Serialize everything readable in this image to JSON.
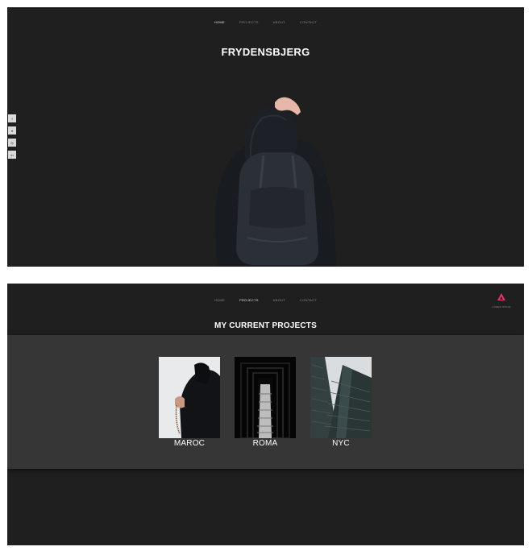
{
  "home": {
    "nav": [
      "HOME",
      "PROJECTS",
      "ABOUT",
      "CONTACT"
    ],
    "active_nav": "HOME",
    "title": "FRYDENSBJERG",
    "social": [
      "f",
      "t",
      "ig",
      "in"
    ]
  },
  "projects": {
    "nav": [
      "HOME",
      "PROJECTS",
      "ABOUT",
      "CONTACT"
    ],
    "active_nav": "PROJECTS",
    "logo_caption": "LOREM IPSUM",
    "logo_color": "#e8336c",
    "title": "MY CURRENT PROJECTS",
    "social": [
      "f",
      "t",
      "ig",
      "in"
    ],
    "cards": [
      {
        "label": "MAROC",
        "image": "woman-holding-prayer-beads"
      },
      {
        "label": "ROMA",
        "image": "symmetric-corridor"
      },
      {
        "label": "NYC",
        "image": "glass-skyscraper"
      }
    ]
  },
  "colors": {
    "page_bg": "#1f1f1f",
    "band_bg": "#363636",
    "text": "#ffffff"
  }
}
